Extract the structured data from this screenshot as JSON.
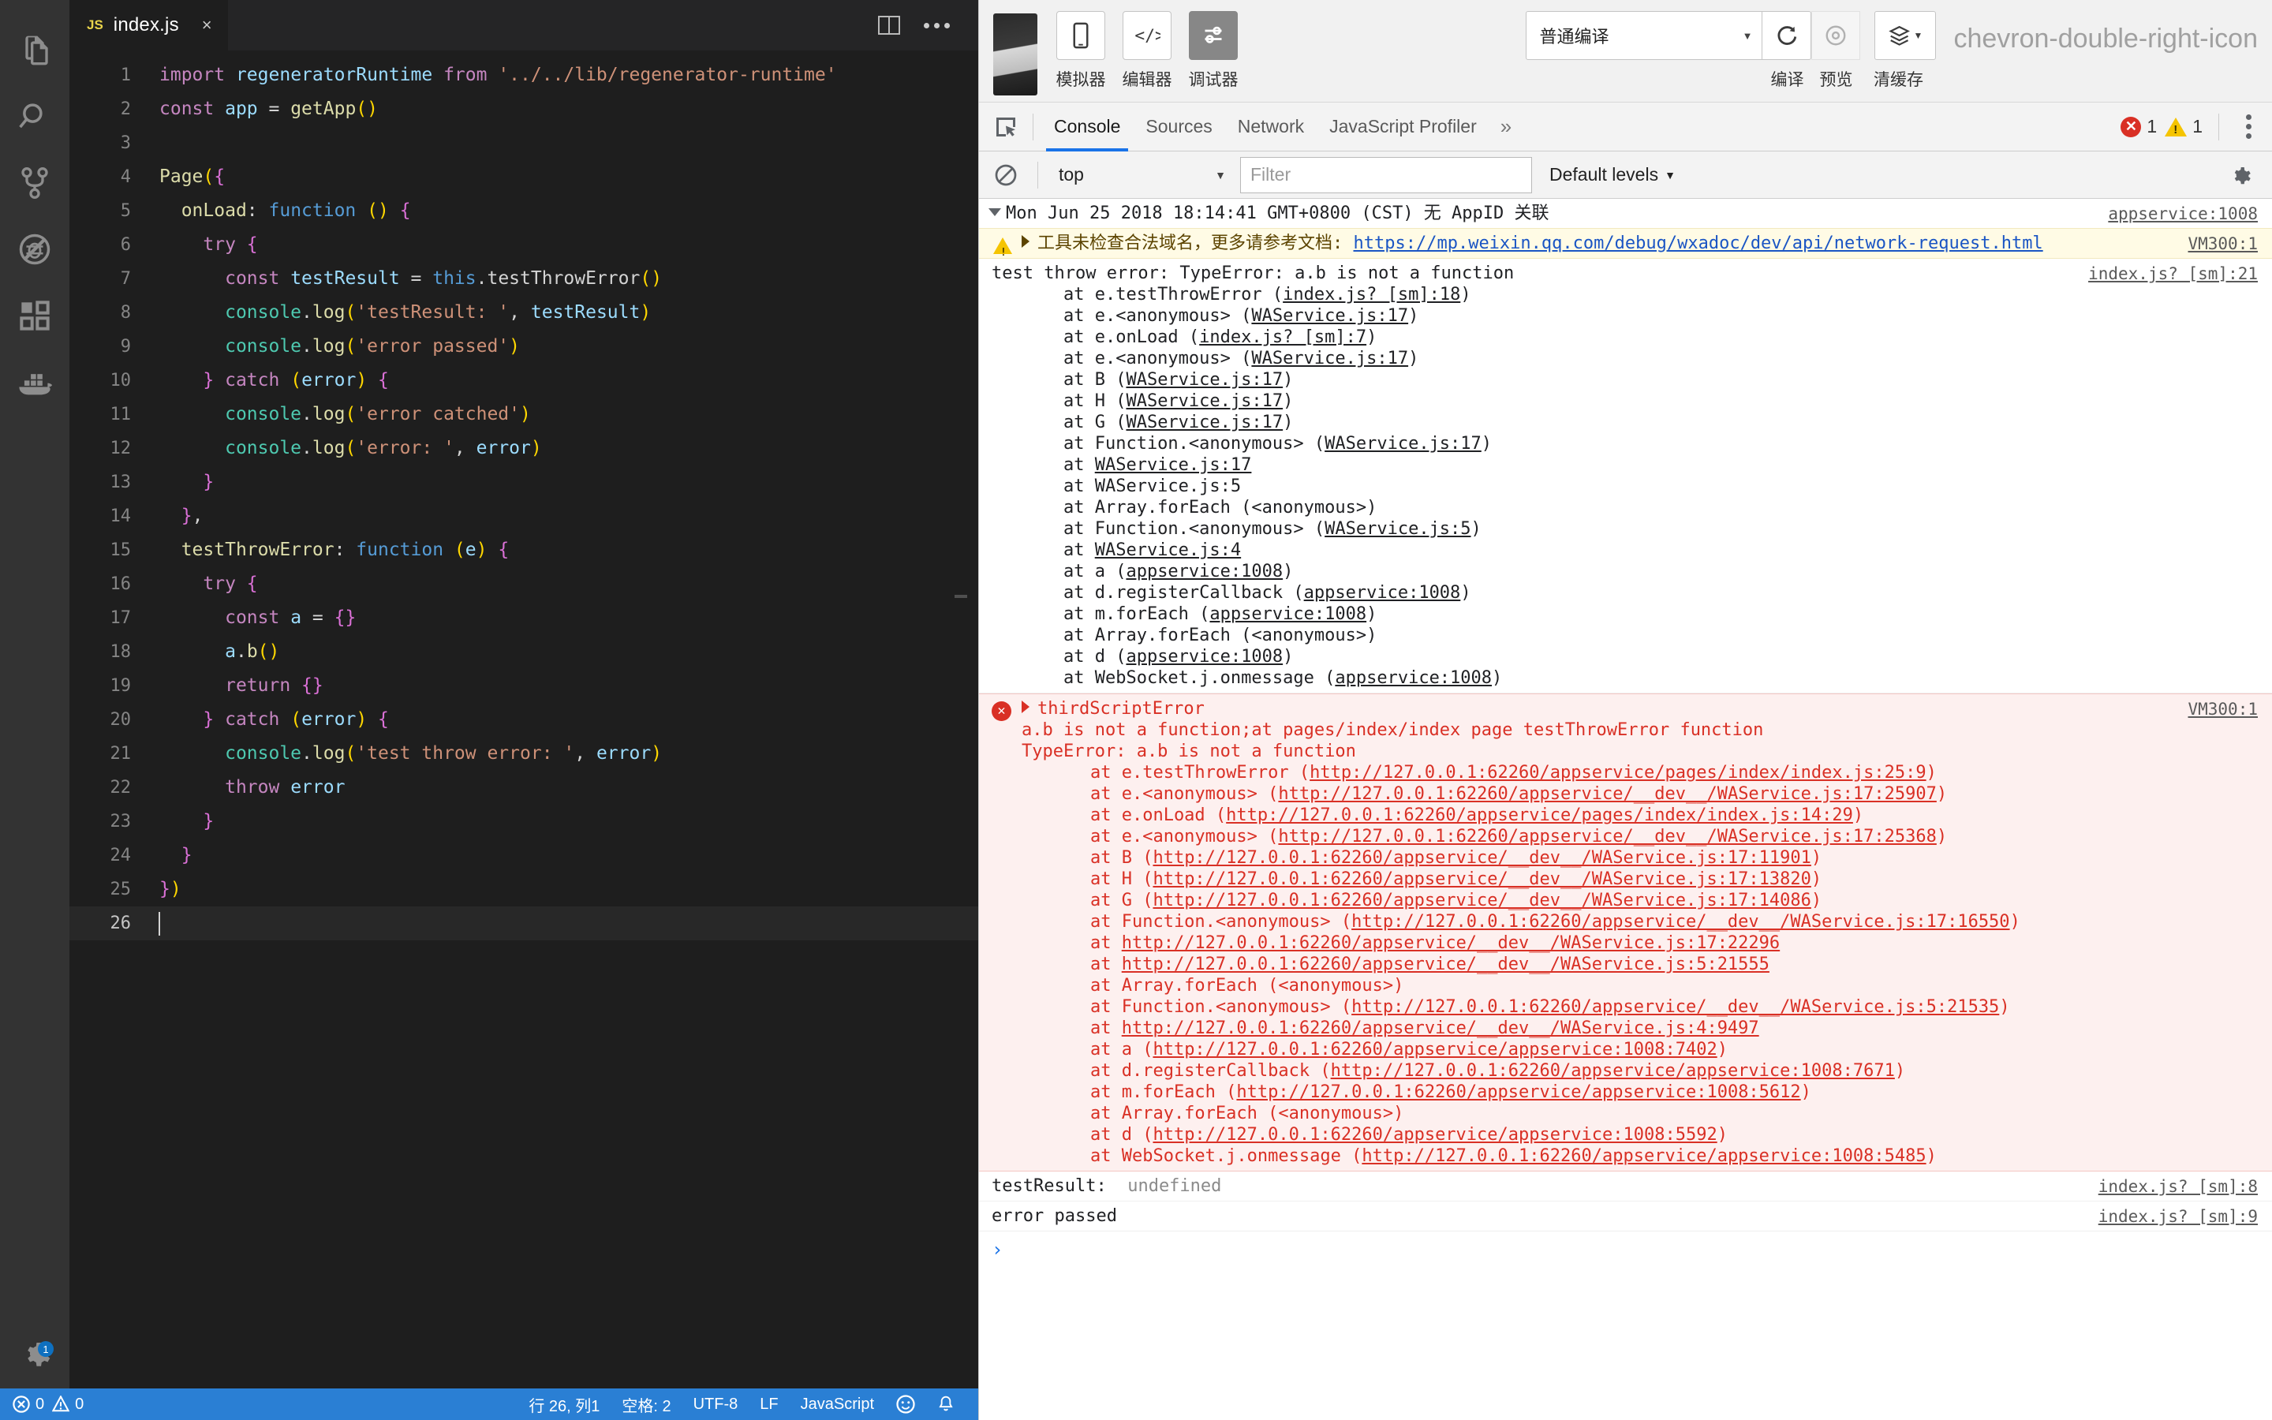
{
  "editor": {
    "activitybar_icons": [
      {
        "name": "files-icon",
        "label": "Explorer"
      },
      {
        "name": "search-icon",
        "label": "Search"
      },
      {
        "name": "source-control-icon",
        "label": "Source Control"
      },
      {
        "name": "no-debug-icon",
        "label": "Debug"
      },
      {
        "name": "extensions-icon",
        "label": "Extensions"
      },
      {
        "name": "docker-icon",
        "label": "Docker"
      },
      {
        "name": "settings-gear-icon",
        "label": "Manage"
      }
    ],
    "settings_badge": "1",
    "tab": {
      "file_type": "JS",
      "label": "index.js",
      "close": "×"
    },
    "actions": {
      "split_editor": "split-editor",
      "more_actions": "•••"
    },
    "code_lines": [
      {
        "n": "1",
        "t": "import regeneratorRuntime from '../../lib/regenerator-runtime'"
      },
      {
        "n": "2",
        "t": "const app = getApp()"
      },
      {
        "n": "3",
        "t": ""
      },
      {
        "n": "4",
        "t": "Page({"
      },
      {
        "n": "5",
        "t": "  onLoad: function () {"
      },
      {
        "n": "6",
        "t": "    try {"
      },
      {
        "n": "7",
        "t": "      const testResult = this.testThrowError()"
      },
      {
        "n": "8",
        "t": "      console.log('testResult: ', testResult)"
      },
      {
        "n": "9",
        "t": "      console.log('error passed')"
      },
      {
        "n": "10",
        "t": "    } catch (error) {"
      },
      {
        "n": "11",
        "t": "      console.log('error catched')"
      },
      {
        "n": "12",
        "t": "      console.log('error: ', error)"
      },
      {
        "n": "13",
        "t": "    }"
      },
      {
        "n": "14",
        "t": "  },"
      },
      {
        "n": "15",
        "t": "  testThrowError: function (e) {"
      },
      {
        "n": "16",
        "t": "    try {"
      },
      {
        "n": "17",
        "t": "      const a = {}"
      },
      {
        "n": "18",
        "t": "      a.b()"
      },
      {
        "n": "19",
        "t": "      return {}"
      },
      {
        "n": "20",
        "t": "    } catch (error) {"
      },
      {
        "n": "21",
        "t": "      console.log('test throw error: ', error)"
      },
      {
        "n": "22",
        "t": "      throw error"
      },
      {
        "n": "23",
        "t": "    }"
      },
      {
        "n": "24",
        "t": "  }"
      },
      {
        "n": "25",
        "t": "})"
      },
      {
        "n": "26",
        "t": ""
      }
    ],
    "statusbar": {
      "errors": "0",
      "warnings": "0",
      "position": "行 26, 列1",
      "spaces": "空格: 2",
      "encoding": "UTF-8",
      "eol": "LF",
      "language": "JavaScript",
      "feedback_icon": "smiley-icon",
      "bell_icon": "bell-icon"
    }
  },
  "devtools": {
    "toolbar": {
      "buttons": [
        {
          "label": "模拟器",
          "icon": "phone-icon",
          "active": false
        },
        {
          "label": "编辑器",
          "icon": "code-icon",
          "active": false
        },
        {
          "label": "调试器",
          "icon": "debug-icon",
          "active": true
        }
      ],
      "compile_mode": "普通编译",
      "compile_label": "编译",
      "preview_label": "预览",
      "clearcache_label": "清缓存",
      "refresh_icon": "refresh-icon",
      "preview_icon": "eye-icon",
      "cache_icon": "layers-icon",
      "overflow_icon": "chevron-double-right-icon"
    },
    "tabs": [
      {
        "label": "Console",
        "active": true
      },
      {
        "label": "Sources",
        "active": false
      },
      {
        "label": "Network",
        "active": false
      },
      {
        "label": "JavaScript Profiler",
        "active": false
      }
    ],
    "tabs_overflow": "»",
    "error_count": "1",
    "warning_count": "1",
    "filterbar": {
      "context": "top",
      "filter_placeholder": "Filter",
      "levels": "Default levels"
    },
    "console": {
      "group_header": {
        "text": "Mon Jun 25 2018 18:14:41 GMT+0800 (CST) 无 AppID 关联",
        "source": "appservice:1008"
      },
      "warning": {
        "text": "工具未检查合法域名，更多请参考文档: ",
        "link": "https://mp.weixin.qq.com/debug/wxadoc/dev/api/network-request.html",
        "source": "VM300:1"
      },
      "log_error": {
        "title": "test throw error:  TypeError: a.b is not a function",
        "source": "index.js? [sm]:21",
        "stack": [
          {
            "pre": "    at e.testThrowError (",
            "link": "index.js? [sm]:18",
            "post": ")"
          },
          {
            "pre": "    at e.<anonymous> (",
            "link": "WAService.js:17",
            "post": ")"
          },
          {
            "pre": "    at e.onLoad (",
            "link": "index.js? [sm]:7",
            "post": ")"
          },
          {
            "pre": "    at e.<anonymous> (",
            "link": "WAService.js:17",
            "post": ")"
          },
          {
            "pre": "    at B (",
            "link": "WAService.js:17",
            "post": ")"
          },
          {
            "pre": "    at H (",
            "link": "WAService.js:17",
            "post": ")"
          },
          {
            "pre": "    at G (",
            "link": "WAService.js:17",
            "post": ")"
          },
          {
            "pre": "    at Function.<anonymous> (",
            "link": "WAService.js:17",
            "post": ")"
          },
          {
            "pre": "    at ",
            "link": "WAService.js:17",
            "post": ""
          },
          {
            "pre": "    at WAService.js:5",
            "link": "",
            "post": ""
          },
          {
            "pre": "    at Array.forEach (<anonymous>)",
            "link": "",
            "post": ""
          },
          {
            "pre": "    at Function.<anonymous> (",
            "link": "WAService.js:5",
            "post": ")"
          },
          {
            "pre": "    at ",
            "link": "WAService.js:4",
            "post": ""
          },
          {
            "pre": "    at a (",
            "link": "appservice:1008",
            "post": ")"
          },
          {
            "pre": "    at d.registerCallback (",
            "link": "appservice:1008",
            "post": ")"
          },
          {
            "pre": "    at m.forEach (",
            "link": "appservice:1008",
            "post": ")"
          },
          {
            "pre": "    at Array.forEach (<anonymous>)",
            "link": "",
            "post": ""
          },
          {
            "pre": "    at d (",
            "link": "appservice:1008",
            "post": ")"
          },
          {
            "pre": "    at WebSocket.j.onmessage (",
            "link": "appservice:1008",
            "post": ")"
          }
        ]
      },
      "third_script_error": {
        "title": "thirdScriptError",
        "source": "VM300:1",
        "line1": "a.b is not a function;at pages/index/index page testThrowError function",
        "line2": "TypeError: a.b is not a function",
        "stack": [
          {
            "pre": "    at e.testThrowError (",
            "link": "http://127.0.0.1:62260/appservice/pages/index/index.js:25:9",
            "post": ")"
          },
          {
            "pre": "    at e.<anonymous> (",
            "link": "http://127.0.0.1:62260/appservice/__dev__/WAService.js:17:25907",
            "post": ")"
          },
          {
            "pre": "    at e.onLoad (",
            "link": "http://127.0.0.1:62260/appservice/pages/index/index.js:14:29",
            "post": ")"
          },
          {
            "pre": "    at e.<anonymous> (",
            "link": "http://127.0.0.1:62260/appservice/__dev__/WAService.js:17:25368",
            "post": ")"
          },
          {
            "pre": "    at B (",
            "link": "http://127.0.0.1:62260/appservice/__dev__/WAService.js:17:11901",
            "post": ")"
          },
          {
            "pre": "    at H (",
            "link": "http://127.0.0.1:62260/appservice/__dev__/WAService.js:17:13820",
            "post": ")"
          },
          {
            "pre": "    at G (",
            "link": "http://127.0.0.1:62260/appservice/__dev__/WAService.js:17:14086",
            "post": ")"
          },
          {
            "pre": "    at Function.<anonymous> (",
            "link": "http://127.0.0.1:62260/appservice/__dev__/WAService.js:17:16550",
            "post": ")"
          },
          {
            "pre": "    at ",
            "link": "http://127.0.0.1:62260/appservice/__dev__/WAService.js:17:22296",
            "post": ""
          },
          {
            "pre": "    at ",
            "link": "http://127.0.0.1:62260/appservice/__dev__/WAService.js:5:21555",
            "post": ""
          },
          {
            "pre": "    at Array.forEach (<anonymous>)",
            "link": "",
            "post": ""
          },
          {
            "pre": "    at Function.<anonymous> (",
            "link": "http://127.0.0.1:62260/appservice/__dev__/WAService.js:5:21535",
            "post": ")"
          },
          {
            "pre": "    at ",
            "link": "http://127.0.0.1:62260/appservice/__dev__/WAService.js:4:9497",
            "post": ""
          },
          {
            "pre": "    at a (",
            "link": "http://127.0.0.1:62260/appservice/appservice:1008:7402",
            "post": ")"
          },
          {
            "pre": "    at d.registerCallback (",
            "link": "http://127.0.0.1:62260/appservice/appservice:1008:7671",
            "post": ")"
          },
          {
            "pre": "    at m.forEach (",
            "link": "http://127.0.0.1:62260/appservice/appservice:1008:5612",
            "post": ")"
          },
          {
            "pre": "    at Array.forEach (<anonymous>)",
            "link": "",
            "post": ""
          },
          {
            "pre": "    at d (",
            "link": "http://127.0.0.1:62260/appservice/appservice:1008:5592",
            "post": ")"
          },
          {
            "pre": "    at WebSocket.j.onmessage (",
            "link": "http://127.0.0.1:62260/appservice/appservice:1008:5485",
            "post": ")"
          }
        ]
      },
      "log_rows": [
        {
          "label": "testResult:",
          "value": "undefined",
          "source": "index.js? [sm]:8"
        },
        {
          "label": "error passed",
          "value": "",
          "source": "index.js? [sm]:9"
        }
      ],
      "prompt": "›"
    }
  }
}
